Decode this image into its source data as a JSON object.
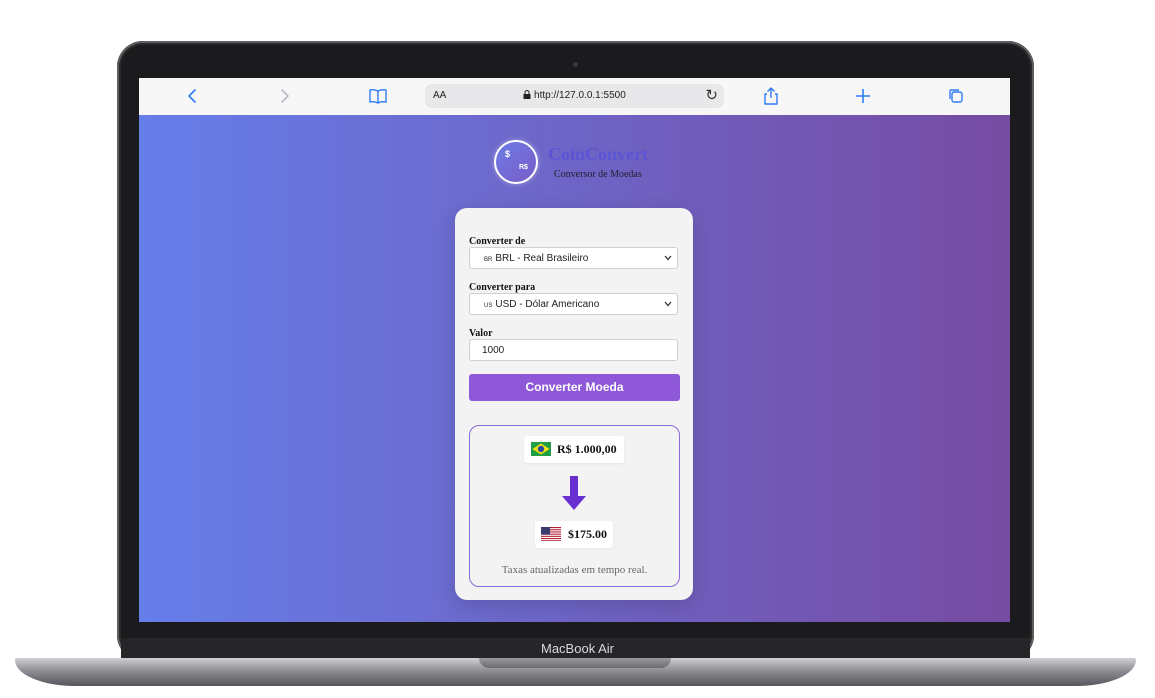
{
  "browser": {
    "address_aa": "AA",
    "url": "http://127.0.0.1:5500"
  },
  "device": {
    "model": "MacBook Air"
  },
  "app": {
    "brand": "CoinConvert",
    "subtitle": "Conversor de Moedas",
    "logo": {
      "top": "$",
      "bottom": "R$"
    }
  },
  "form": {
    "from_label": "Converter de",
    "from_code": "BR",
    "from_value": "BRL - Real Brasileiro",
    "to_label": "Converter para",
    "to_code": "US",
    "to_value": "USD - Dólar Americano",
    "amount_label": "Valor",
    "amount_value": "1000",
    "button_label": "Converter Moeda"
  },
  "result": {
    "from_amount": "R$ 1.000,00",
    "to_amount": "$175.00",
    "note": "Taxas atualizadas em tempo real."
  },
  "colors": {
    "gradient_start": "#667eea",
    "gradient_end": "#764ba2",
    "button": "#8e58d8",
    "accent_link": "#2f7bf5"
  },
  "icons": [
    "back-icon",
    "forward-icon",
    "bookmarks-icon",
    "lock-icon",
    "reload-icon",
    "share-icon",
    "new-tab-icon",
    "tabs-icon",
    "chevron-down-icon",
    "brazil-flag-icon",
    "usa-flag-icon",
    "arrow-down-icon",
    "coin-logo-icon"
  ]
}
